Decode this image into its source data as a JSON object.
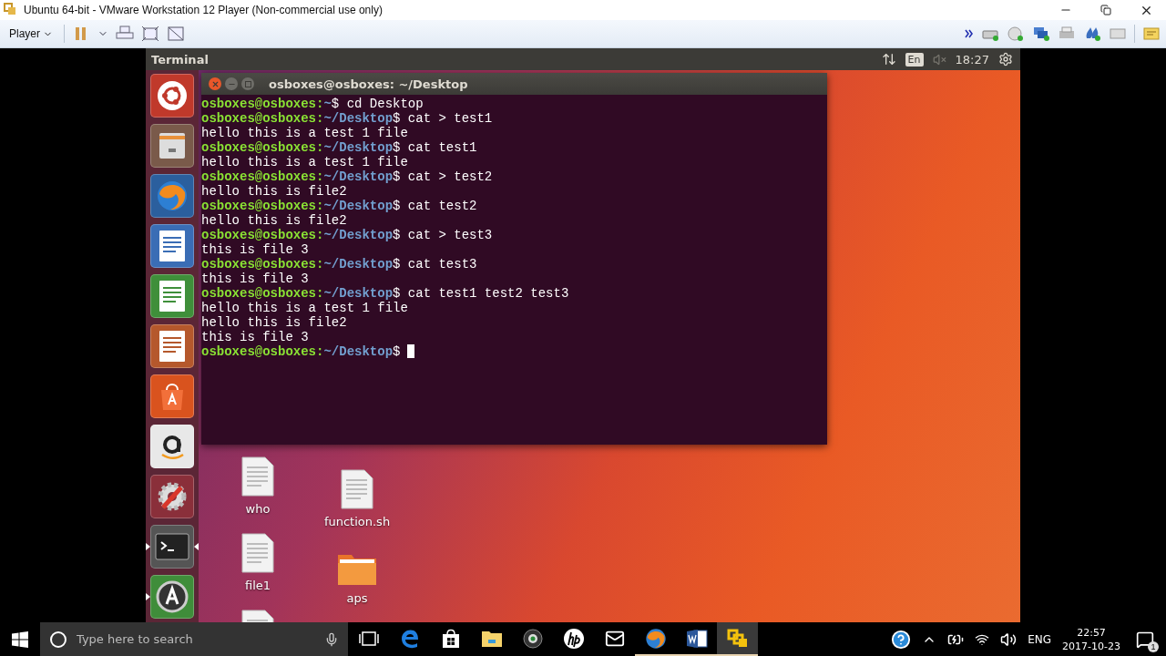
{
  "window": {
    "title": "Ubuntu 64-bit - VMware Workstation 12 Player (Non-commercial use only)"
  },
  "toolbar": {
    "menu": "Player"
  },
  "ubuntu_panel": {
    "app_title": "Terminal",
    "keyboard": "En",
    "muted": true,
    "time": "18:27"
  },
  "launcher": [
    {
      "kind": "ubuntu",
      "running": false,
      "focused": false
    },
    {
      "kind": "files",
      "running": false,
      "focused": false
    },
    {
      "kind": "firefox",
      "running": false,
      "focused": false
    },
    {
      "kind": "writer",
      "running": false,
      "focused": false
    },
    {
      "kind": "calc",
      "running": false,
      "focused": false
    },
    {
      "kind": "impress",
      "running": false,
      "focused": false
    },
    {
      "kind": "software",
      "running": false,
      "focused": false
    },
    {
      "kind": "amazon",
      "running": false,
      "focused": false
    },
    {
      "kind": "settings",
      "running": false,
      "focused": false
    },
    {
      "kind": "terminal",
      "running": true,
      "focused": true
    },
    {
      "kind": "updater",
      "running": true,
      "focused": false
    }
  ],
  "terminal": {
    "title": "osboxes@osboxes: ~/Desktop",
    "lines": [
      {
        "kind": "prompt",
        "user": "osboxes@osboxes:",
        "path": "~",
        "sign": "$",
        "command": "cd Desktop"
      },
      {
        "kind": "prompt",
        "user": "osboxes@osboxes:",
        "path": "~/Desktop",
        "sign": "$",
        "command": "cat > test1"
      },
      {
        "kind": "output",
        "text": "hello this is a test 1 file"
      },
      {
        "kind": "prompt",
        "user": "osboxes@osboxes:",
        "path": "~/Desktop",
        "sign": "$",
        "command": "cat test1"
      },
      {
        "kind": "output",
        "text": "hello this is a test 1 file"
      },
      {
        "kind": "prompt",
        "user": "osboxes@osboxes:",
        "path": "~/Desktop",
        "sign": "$",
        "command": "cat > test2"
      },
      {
        "kind": "output",
        "text": "hello this is file2"
      },
      {
        "kind": "prompt",
        "user": "osboxes@osboxes:",
        "path": "~/Desktop",
        "sign": "$",
        "command": "cat test2"
      },
      {
        "kind": "output",
        "text": "hello this is file2"
      },
      {
        "kind": "prompt",
        "user": "osboxes@osboxes:",
        "path": "~/Desktop",
        "sign": "$",
        "command": "cat > test3"
      },
      {
        "kind": "output",
        "text": "this is file 3"
      },
      {
        "kind": "prompt",
        "user": "osboxes@osboxes:",
        "path": "~/Desktop",
        "sign": "$",
        "command": "cat test3"
      },
      {
        "kind": "output",
        "text": "this is file 3"
      },
      {
        "kind": "prompt",
        "user": "osboxes@osboxes:",
        "path": "~/Desktop",
        "sign": "$",
        "command": "cat test1 test2 test3"
      },
      {
        "kind": "output",
        "text": "hello this is a test 1 file"
      },
      {
        "kind": "output",
        "text": "hello this is file2"
      },
      {
        "kind": "output",
        "text": "this is file 3"
      },
      {
        "kind": "prompt",
        "user": "osboxes@osboxes:",
        "path": "~/Desktop",
        "sign": "$",
        "cursor": true
      }
    ]
  },
  "desktop_icons": [
    {
      "kind": "file",
      "label": "who"
    },
    {
      "kind": "file",
      "label": "function.sh"
    },
    {
      "kind": "file",
      "label": "file1"
    },
    {
      "kind": "folder",
      "label": "aps"
    },
    {
      "kind": "file"
    }
  ],
  "taskbar": {
    "search": {
      "placeholder": "Type here to search"
    },
    "apps": [
      {
        "kind": "taskview",
        "open": false,
        "selected": false
      },
      {
        "kind": "edge",
        "open": false,
        "selected": false
      },
      {
        "kind": "store",
        "open": false,
        "selected": false
      },
      {
        "kind": "explorer",
        "open": false,
        "selected": false
      },
      {
        "kind": "camera",
        "open": false,
        "selected": false
      },
      {
        "kind": "hp",
        "open": false,
        "selected": false
      },
      {
        "kind": "mail",
        "open": false,
        "selected": false
      },
      {
        "kind": "firefox",
        "open": true,
        "selected": false
      },
      {
        "kind": "word",
        "open": true,
        "selected": false
      },
      {
        "kind": "vmware",
        "open": true,
        "selected": true
      }
    ],
    "tray": {
      "language": "ENG",
      "time": "22:57",
      "date": "2017-10-23",
      "notifications": "1"
    }
  }
}
